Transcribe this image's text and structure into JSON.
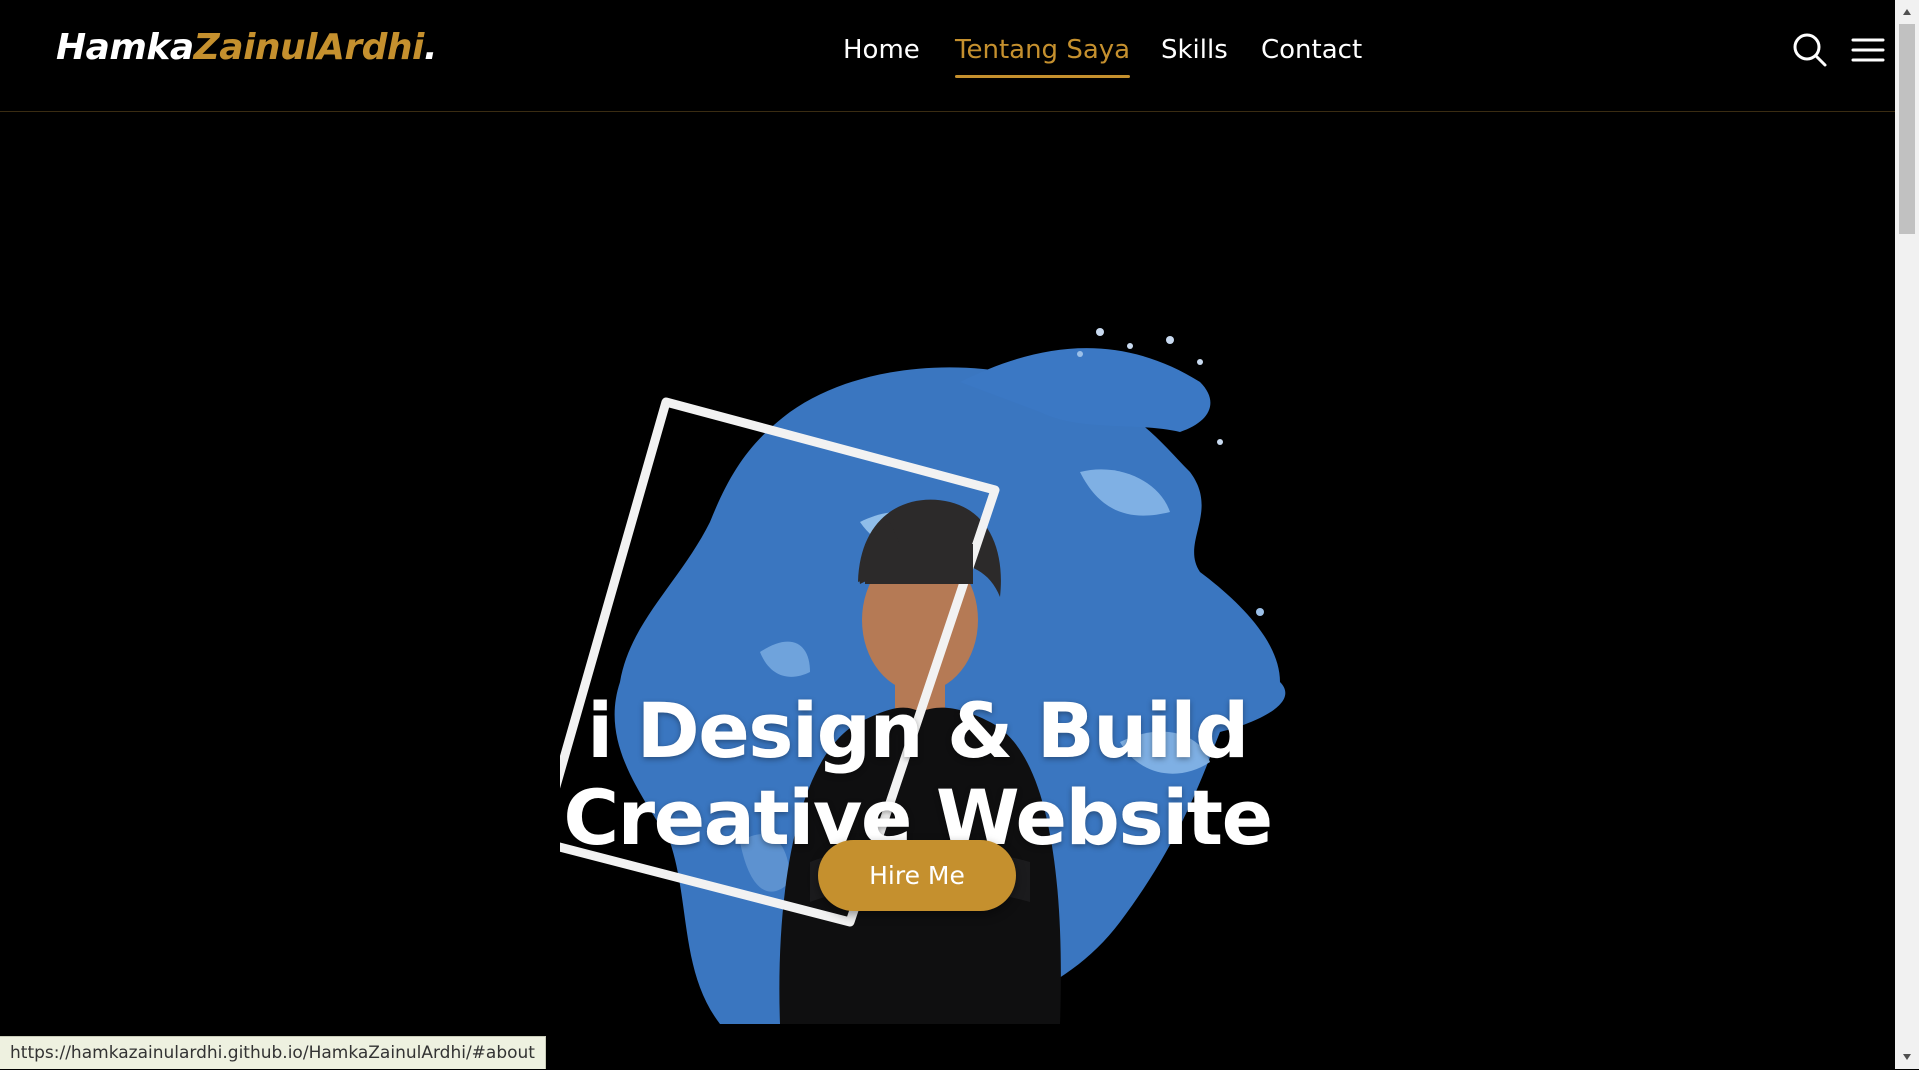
{
  "brand": {
    "part1": "Hamka",
    "part2": "ZainulArdhi",
    "dot": "."
  },
  "nav": {
    "items": [
      {
        "label": "Home"
      },
      {
        "label": "Tentang Saya"
      },
      {
        "label": "Skills"
      },
      {
        "label": "Contact"
      }
    ]
  },
  "hero": {
    "title_line1": "i Design & Build",
    "title_line2": "Creative Website",
    "cta_label": "Hire Me"
  },
  "status_bar": {
    "url": "https://hamkazainulardhi.github.io/HamkaZainulArdhi/#about"
  },
  "colors": {
    "accent": "#c5902e",
    "background": "#000000",
    "paint": "#3a76c0"
  },
  "icons": [
    "search-icon",
    "menu-icon",
    "scroll-up-arrow-icon",
    "scroll-down-arrow-icon"
  ]
}
